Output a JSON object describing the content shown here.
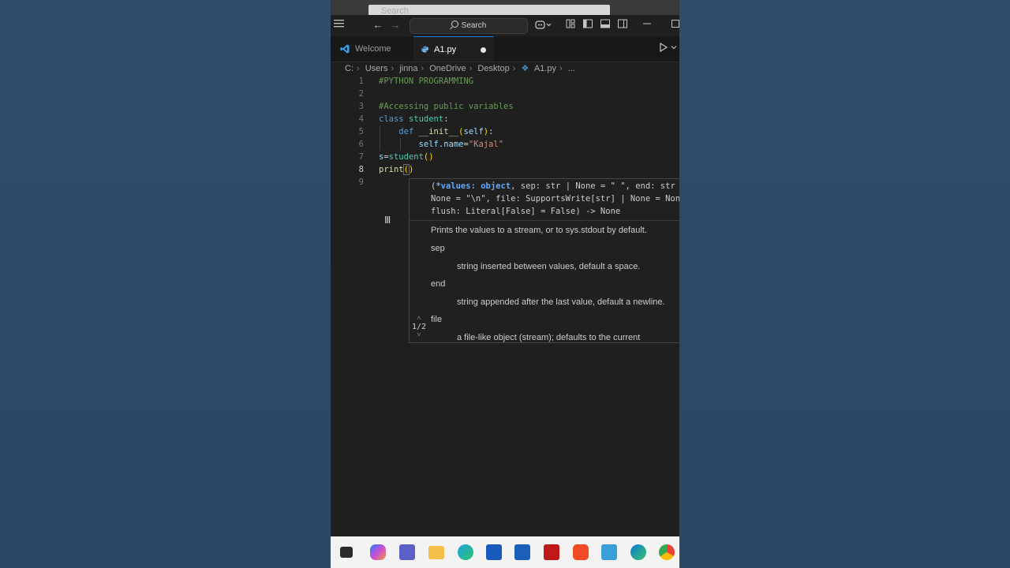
{
  "top_search": {
    "placeholder": "Search"
  },
  "titlebar": {
    "search_label": "Search"
  },
  "tabs": [
    {
      "label": "Welcome",
      "active": false,
      "icon": "vscode-icon"
    },
    {
      "label": "A1.py",
      "active": true,
      "icon": "python-file-icon",
      "modified": true
    }
  ],
  "breadcrumb": [
    "C:",
    "Users",
    "jinna",
    "OneDrive",
    "Desktop",
    "A1.py",
    "..."
  ],
  "editor": {
    "line_numbers": [
      "1",
      "2",
      "3",
      "4",
      "5",
      "6",
      "7",
      "8",
      "9"
    ],
    "current_line": "8",
    "lines": [
      "#PYTHON PROGRAMMING",
      "",
      "#Accessing public variables",
      "class student:",
      "    def __init__(self):",
      "        self.name=\"Kajal\"",
      "s=student()",
      "print()",
      ""
    ]
  },
  "hover": {
    "signature_1": "(*values: object, sep: str | None = \" \", end: str",
    "signature_2": "None = \"\\n\", file: SupportsWrite[str] | None = None",
    "signature_3": "flush: Literal[False] = False) -> None",
    "signature_bold": "*values: object",
    "summary": "Prints the values to a stream, or to sys.stdout by default.",
    "params": [
      {
        "name": "sep",
        "desc": "string inserted between values, default a space."
      },
      {
        "name": "end",
        "desc": "string appended after the last value, default a newline."
      },
      {
        "name": "file",
        "desc": "a file-like object (stream); defaults to the current"
      }
    ],
    "pager": "1/2"
  },
  "colors": {
    "accent": "#0078d4",
    "comment": "#6a9955",
    "keyword": "#569cd6",
    "class": "#4ec9b0",
    "function": "#dcdcaa",
    "string": "#ce9178",
    "variable": "#9cdcfe"
  },
  "taskbar_icons": [
    "file-explorer-app-icon",
    "copilot-icon",
    "teams-icon",
    "folder-icon",
    "edge-beta-icon",
    "word-icon",
    "store-icon",
    "mcafee-icon",
    "brave-icon",
    "snipping-icon",
    "edge-icon",
    "chrome-icon"
  ]
}
